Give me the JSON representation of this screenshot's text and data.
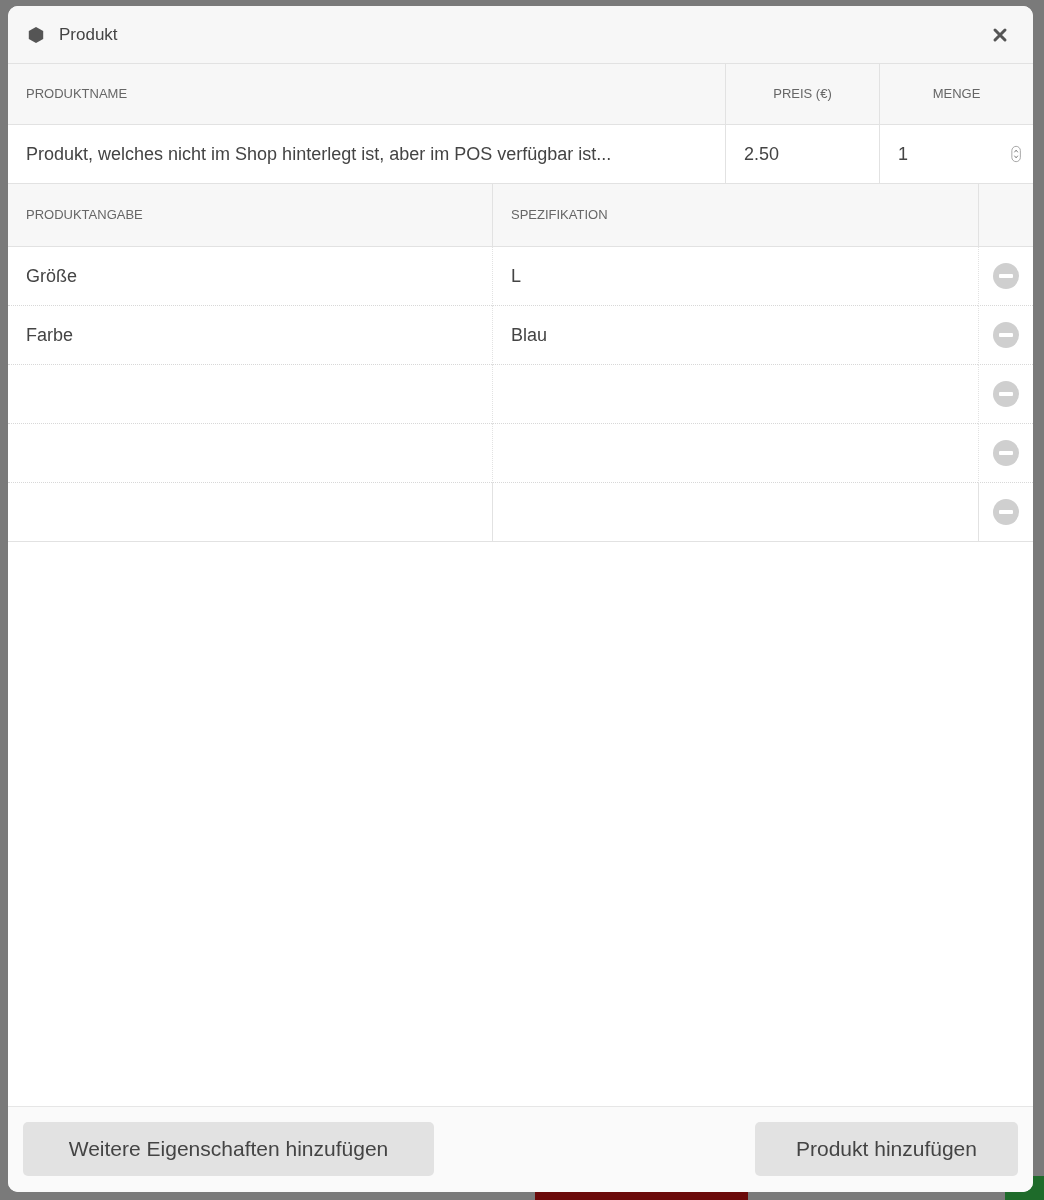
{
  "dialog": {
    "title": "Produkt"
  },
  "product_table": {
    "columns": [
      "PRODUKTNAME",
      "PREIS (€)",
      "MENGE"
    ],
    "row": {
      "name": "Produkt, welches nicht im Shop hinterlegt ist, aber im POS verfügbar ist...",
      "price": "2.50",
      "quantity": "1"
    }
  },
  "attribute_table": {
    "columns": [
      "PRODUKTANGABE",
      "SPEZIFIKATION"
    ],
    "rows": [
      {
        "attribute": "Größe",
        "value": "L"
      },
      {
        "attribute": "Farbe",
        "value": "Blau"
      },
      {},
      {},
      {}
    ]
  },
  "buttons": [
    "Weitere Eigenschaften hinzufügen",
    "Produkt hinzufügen"
  ]
}
